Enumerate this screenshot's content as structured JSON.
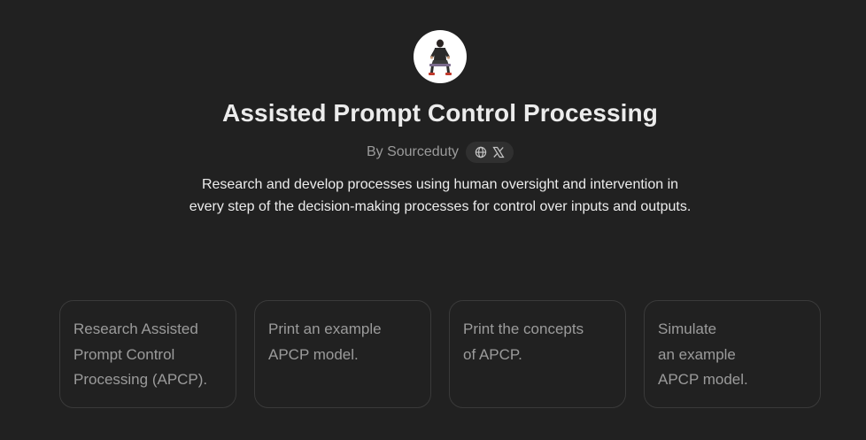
{
  "gpt": {
    "title": "Assisted Prompt Control Processing",
    "byline": "By Sourceduty",
    "description": "Research and develop processes using human oversight and intervention in every step of the decision-making processes for control over inputs and outputs.",
    "avatar_icon": "person-sitting-icon",
    "social_icons": [
      "globe-icon",
      "x-logo-icon"
    ]
  },
  "starters": [
    {
      "label": "Research Assisted\nPrompt Control\nProcessing (APCP)."
    },
    {
      "label": "Print an example\nAPCP model."
    },
    {
      "label": "Print the concepts\nof APCP."
    },
    {
      "label": "Simulate\nan example\nAPCP model."
    }
  ],
  "colors": {
    "background": "#212121",
    "text": "#ececec",
    "muted": "#9b9b9b",
    "card_border": "#3a3a3a",
    "pill": "#303030"
  }
}
